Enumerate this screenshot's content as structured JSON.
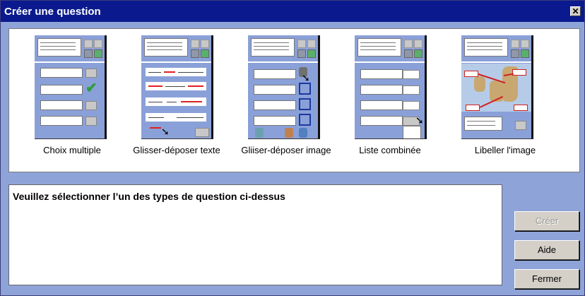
{
  "window": {
    "title": "Créer une question",
    "close_label": "✕"
  },
  "question_types": [
    {
      "label": "Choix multiple"
    },
    {
      "label": "Glisser-déposer texte"
    },
    {
      "label": "Gliiser-déposer image"
    },
    {
      "label": "Liste combinée"
    },
    {
      "label": "Libeller l'image"
    }
  ],
  "prompt": {
    "text": "Veuillez sélectionner l’un des types de question ci-dessus"
  },
  "buttons": {
    "create_label": "Créer",
    "help_label": "Aide",
    "close_label": "Fermer"
  }
}
